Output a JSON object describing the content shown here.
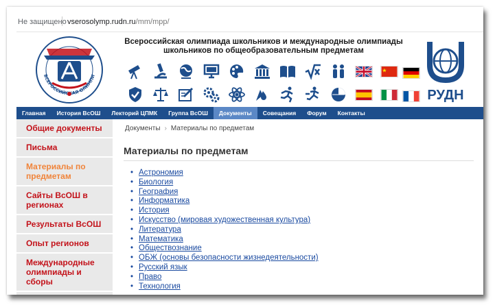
{
  "browser": {
    "security_label": "Не защищено",
    "url_domain": "vserosolymp.rudn.ru",
    "url_path": "/mm/mpp/"
  },
  "header": {
    "title_line1": "Всероссийская олимпиада школьников и международные олимпиады",
    "title_line2": "школьников по общеобразовательным предметам",
    "left_logo_text": "ВСЕРОССИЙСКАЯ ОЛИМПИАДА ШКОЛЬНИКОВ",
    "right_logo_text": "РУДН",
    "subject_icons_row1": [
      "telescope-icon",
      "microscope-icon",
      "globe-icon",
      "computer-icon",
      "palette-icon",
      "building-icon",
      "book-icon",
      "sqrt-icon",
      "people-icon"
    ],
    "subject_icons_row2": [
      "shield-icon",
      "scales-icon",
      "writing-icon",
      "gears-icon",
      "atom-icon",
      "drop-icon",
      "runner-icon",
      "runner2-icon",
      "chart-icon"
    ],
    "flags_row1": [
      "flag-uk",
      "flag-china",
      "flag-germany"
    ],
    "flags_row2": [
      "flag-spain",
      "flag-italy",
      "flag-france"
    ],
    "colors": {
      "nav_bg": "#1e4e8c",
      "nav_active": "#5b88c6",
      "logo_blue": "#1e4e8c",
      "logo_red": "#c3121a"
    }
  },
  "nav": {
    "items": [
      "Главная",
      "История ВсОШ",
      "Лекторий ЦПМК",
      "Группа ВсОШ",
      "Документы",
      "Совещания",
      "Форум",
      "Контакты"
    ],
    "active": "Документы"
  },
  "sidebar": {
    "items": [
      "Общие документы",
      "Письма",
      "Материалы по предметам",
      "Сайты ВсОШ в регионах",
      "Результаты ВсОШ",
      "Опыт регионов",
      "Международные олимпиады и сборы"
    ],
    "current": "Материалы по предметам"
  },
  "main": {
    "breadcrumb": [
      "Документы",
      "Материалы по предметам"
    ],
    "heading": "Материалы по предметам",
    "subjects": [
      "Астрономия",
      "Биология",
      "География",
      "Информатика",
      "История",
      "Искусство (мировая художественная культура)",
      "Литература",
      "Математика",
      "Обществознание",
      "ОБЖ (основы безопасности жизнедеятельности)",
      "Русский язык",
      "Право",
      "Технология"
    ]
  }
}
